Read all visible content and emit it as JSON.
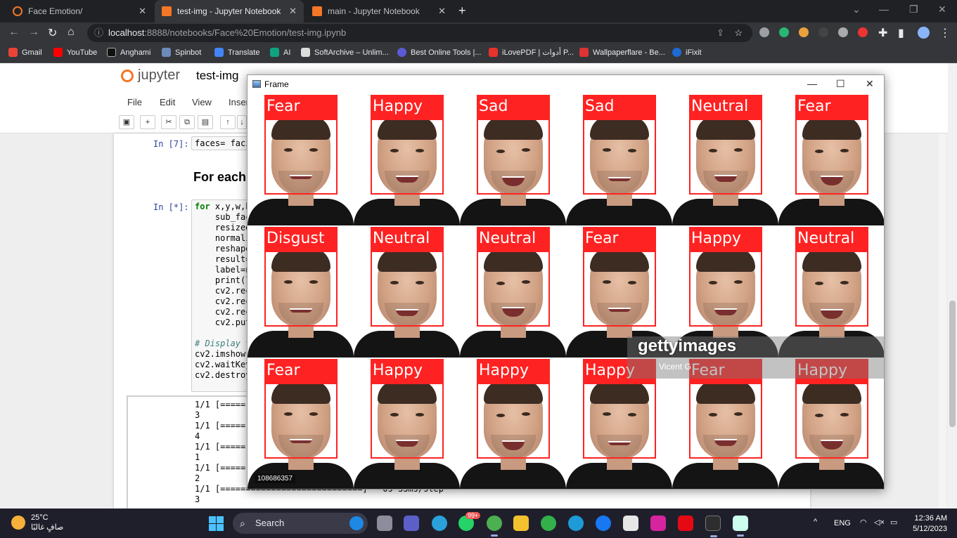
{
  "browser": {
    "tabs": [
      {
        "title": "Face Emotion/",
        "active": false
      },
      {
        "title": "test-img - Jupyter Notebook",
        "active": true
      },
      {
        "title": "main - Jupyter Notebook",
        "active": false
      }
    ],
    "new_tab": "+",
    "url_host": "localhost",
    "url_path": ":8888/notebooks/Face%20Emotion/test-img.ipynb",
    "bookmarks": [
      "Gmail",
      "YouTube",
      "Anghami",
      "Spinbot",
      "Translate",
      "AI",
      "SoftArchive – Unlim...",
      "Best Online Tools |...",
      "iLovePDF | أدوات P...",
      "Wallpaperflare - Be...",
      "iFixit"
    ]
  },
  "jupyter": {
    "logo": "jupyter",
    "notebook_title": "test-img",
    "menu": [
      "File",
      "Edit",
      "View",
      "Inser"
    ],
    "cell1_prompt": "In [7]:",
    "cell1_code": "faces= faci",
    "markdown_heading": "For each",
    "cell2_prompt": "In [*]:",
    "cell2_lines": [
      "for x,y,w,h",
      "    sub_fac",
      "    resized",
      "    normali",
      "    reshape",
      "    result=",
      "    label=n",
      "    print(l",
      "    cv2.rec",
      "    cv2.rec",
      "    cv2.rec",
      "    cv2.put",
      "",
      "# Display t",
      "cv2.imshow(",
      "cv2.waitKey",
      "cv2.destroy"
    ],
    "output_lines": [
      "1/1 [=====",
      "3",
      "1/1 [=====",
      "4",
      "1/1 [=====",
      "1",
      "1/1 [=====",
      "2",
      "1/1 [============================] - 0s 33ms/step",
      "3"
    ]
  },
  "frame_window": {
    "title": "Frame",
    "watermark": "gettyimages",
    "credit": "Vicent G",
    "image_id": "108686357",
    "labels": [
      [
        "Fear",
        "Happy",
        "Sad",
        "Sad",
        "Neutral",
        "Fear"
      ],
      [
        "Disgust",
        "Neutral",
        "Neutral",
        "Fear",
        "Happy",
        "Neutral"
      ],
      [
        "Fear",
        "Happy",
        "Happy",
        "Happy",
        "Fear",
        "Happy"
      ]
    ]
  },
  "taskbar": {
    "temperature": "25°C",
    "weather_text": "صافٍ غالبًا",
    "search_label": "Search",
    "notification_badge": "99+",
    "language": "ENG",
    "time": "12:36 AM",
    "date": "5/12/2023"
  }
}
